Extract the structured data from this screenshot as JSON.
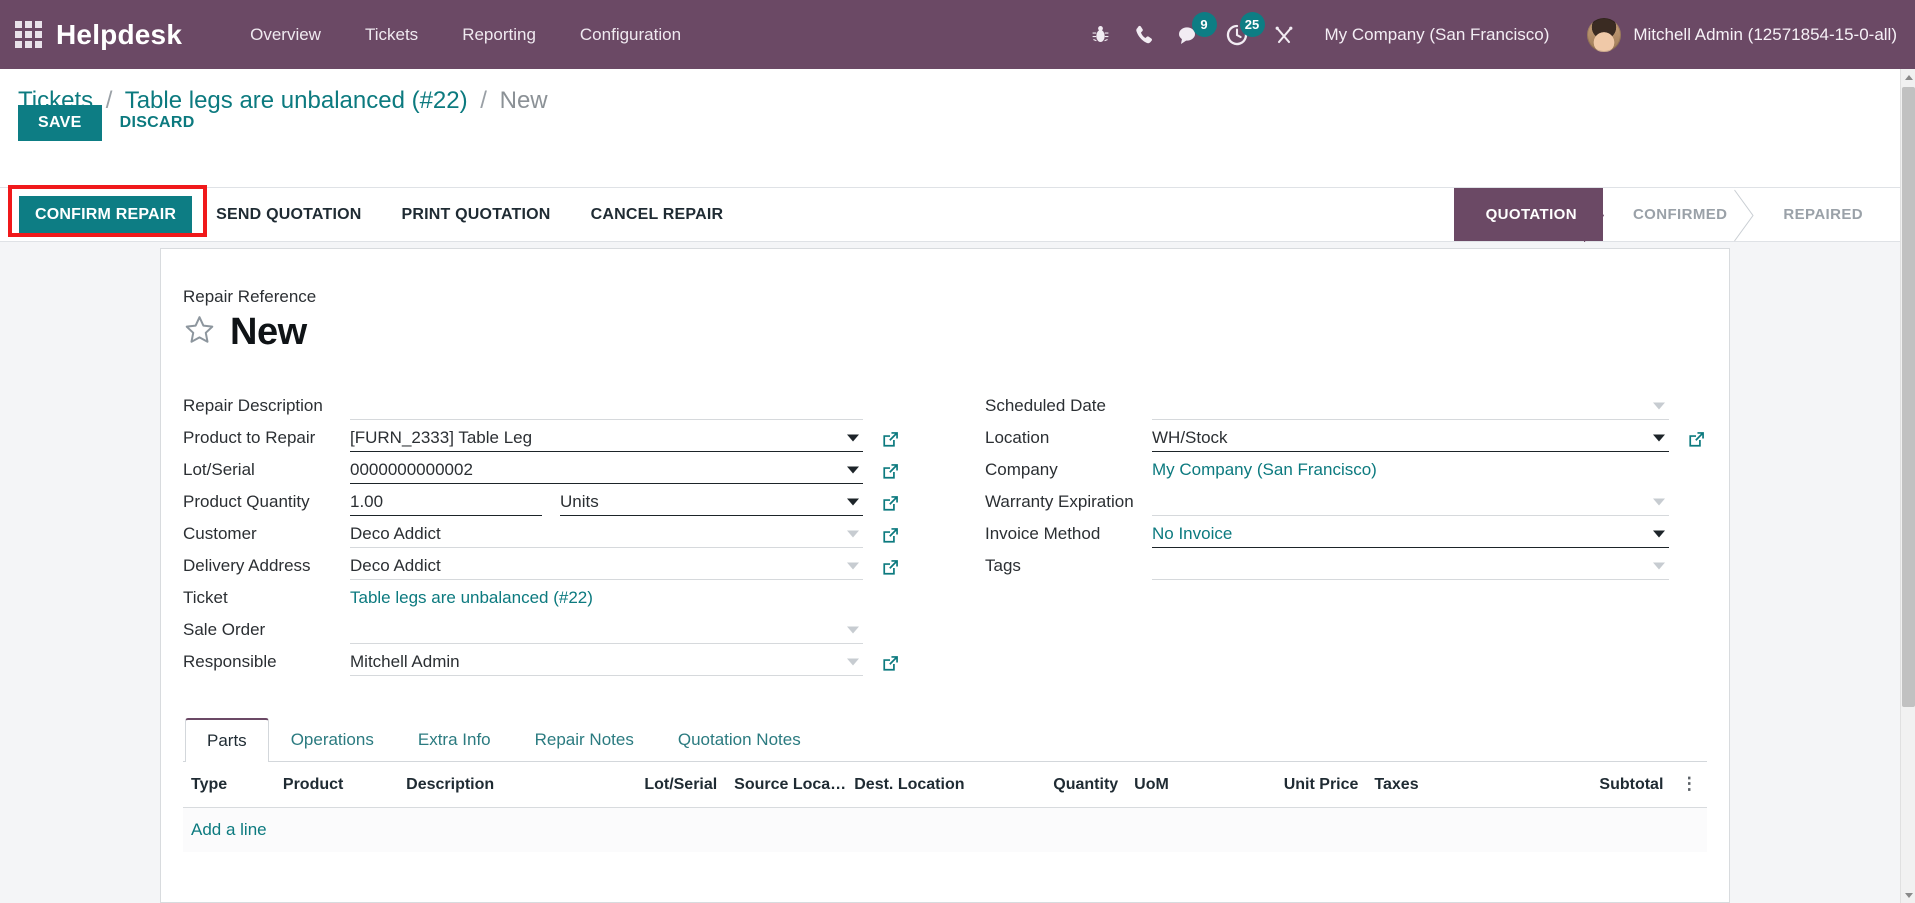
{
  "navbar": {
    "apps_icon": "grid-apps-icon",
    "brand": "Helpdesk",
    "menus": [
      "Overview",
      "Tickets",
      "Reporting",
      "Configuration"
    ],
    "sysicons": [
      {
        "name": "bug-icon",
        "badge": null
      },
      {
        "name": "phone-icon",
        "badge": null
      },
      {
        "name": "messaging-icon",
        "badge": "9"
      },
      {
        "name": "activities-clock-icon",
        "badge": "25"
      },
      {
        "name": "tools-icon",
        "badge": null
      }
    ],
    "company": "My Company (San Francisco)",
    "user": "Mitchell Admin (12571854-15-0-all)"
  },
  "breadcrumb": {
    "root": "Tickets",
    "parent": "Table legs are unbalanced (#22)",
    "current": "New",
    "separator": "/"
  },
  "control_panel": {
    "save_label": "SAVE",
    "discard_label": "DISCARD"
  },
  "statusbar": {
    "buttons": [
      {
        "label": "CONFIRM REPAIR",
        "primary": true,
        "highlighted": true
      },
      {
        "label": "SEND QUOTATION",
        "primary": false,
        "highlighted": false
      },
      {
        "label": "PRINT QUOTATION",
        "primary": false,
        "highlighted": false
      },
      {
        "label": "CANCEL REPAIR",
        "primary": false,
        "highlighted": false
      }
    ],
    "stages": [
      {
        "label": "QUOTATION",
        "active": true
      },
      {
        "label": "CONFIRMED",
        "active": false
      },
      {
        "label": "REPAIRED",
        "active": false
      }
    ],
    "highlight_color": "#f0191b"
  },
  "form": {
    "reference_label": "Repair Reference",
    "record_title": "New",
    "star_icon": "star-outline-icon",
    "left_fields": [
      {
        "label": "Repair Description",
        "value": "",
        "placeholder": "",
        "widget": "text",
        "ext_link": false,
        "caret": "none",
        "strong": false
      },
      {
        "label": "Product to Repair",
        "value": "[FURN_2333] Table Leg",
        "widget": "many2one",
        "ext_link": true,
        "caret": "dark",
        "strong": true
      },
      {
        "label": "Lot/Serial",
        "value": "0000000000002",
        "widget": "many2one",
        "ext_link": true,
        "caret": "dark",
        "strong": true
      },
      {
        "label": "Product Quantity",
        "value": "1.00",
        "uom": "Units",
        "widget": "quantity",
        "ext_link": true,
        "caret": "dark",
        "strong": true
      },
      {
        "label": "Customer",
        "value": "Deco Addict",
        "widget": "many2one",
        "ext_link": true,
        "caret": "muted",
        "strong": false
      },
      {
        "label": "Delivery Address",
        "value": "Deco Addict",
        "widget": "many2one",
        "ext_link": true,
        "caret": "muted",
        "strong": false
      },
      {
        "label": "Ticket",
        "value": "Table legs are unbalanced (#22)",
        "widget": "readonly-link",
        "ext_link": false,
        "caret": "none",
        "strong": false
      },
      {
        "label": "Sale Order",
        "value": "",
        "widget": "many2one",
        "ext_link": false,
        "caret": "muted",
        "strong": false
      },
      {
        "label": "Responsible",
        "value": "Mitchell Admin",
        "widget": "many2one",
        "ext_link": true,
        "caret": "muted",
        "strong": false
      }
    ],
    "right_fields": [
      {
        "label": "Scheduled Date",
        "value": "",
        "widget": "datetime",
        "ext_link": false,
        "caret": "muted",
        "strong": false
      },
      {
        "label": "Location",
        "value": "WH/Stock",
        "widget": "many2one",
        "ext_link": true,
        "caret": "dark",
        "strong": true
      },
      {
        "label": "Company",
        "value": "My Company (San Francisco)",
        "widget": "readonly-link",
        "ext_link": false,
        "caret": "none",
        "strong": false
      },
      {
        "label": "Warranty Expiration",
        "value": "",
        "widget": "date",
        "ext_link": false,
        "caret": "muted",
        "strong": false
      },
      {
        "label": "Invoice Method",
        "value": "No Invoice",
        "widget": "selection",
        "ext_link": false,
        "caret": "dark",
        "strong": true
      },
      {
        "label": "Tags",
        "value": "",
        "widget": "many2many_tags",
        "ext_link": false,
        "caret": "muted",
        "strong": false
      }
    ]
  },
  "notebook": {
    "tabs": [
      {
        "label": "Parts",
        "active": true
      },
      {
        "label": "Operations",
        "active": false
      },
      {
        "label": "Extra Info",
        "active": false
      },
      {
        "label": "Repair Notes",
        "active": false
      },
      {
        "label": "Quotation Notes",
        "active": false
      }
    ],
    "columns": [
      {
        "label": "Type",
        "align": "left"
      },
      {
        "label": "Product",
        "align": "left"
      },
      {
        "label": "Description",
        "align": "left"
      },
      {
        "label": "Lot/Serial",
        "align": "left"
      },
      {
        "label": "Source Loca…",
        "align": "left"
      },
      {
        "label": "Dest. Location",
        "align": "left"
      },
      {
        "label": "Quantity",
        "align": "right"
      },
      {
        "label": "UoM",
        "align": "left"
      },
      {
        "label": "Unit Price",
        "align": "right"
      },
      {
        "label": "Taxes",
        "align": "left"
      },
      {
        "label": "Subtotal",
        "align": "right"
      }
    ],
    "rows": [],
    "add_line_label": "Add a line",
    "optional_columns_icon": "vertical-dots-icon"
  },
  "colors": {
    "navbar": "#6b4965",
    "accent": "#0d7d84",
    "link": "#0c7a7f",
    "page_bg": "#f4f5f7",
    "highlight": "#f0191b"
  },
  "scrollbar": {
    "up_icon": "scroll-up-arrow-icon",
    "down_icon": "scroll-down-arrow-icon"
  }
}
